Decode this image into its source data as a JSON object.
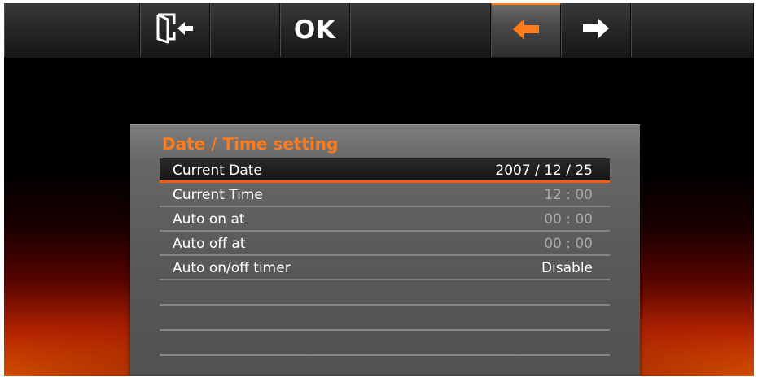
{
  "toolbar": {
    "ok_label": "OK",
    "buttons": [
      {
        "name": "exit",
        "icon": "exit-door-icon"
      },
      {
        "name": "ok",
        "label": "OK"
      },
      {
        "name": "back",
        "icon": "arrow-left-icon",
        "active": true
      },
      {
        "name": "forward",
        "icon": "arrow-right-icon"
      }
    ]
  },
  "colors": {
    "accent": "#ff7b1c",
    "selection_underline": "#ff5a14"
  },
  "panel": {
    "title": "Date / Time setting",
    "rows": [
      {
        "label": "Current Date",
        "value": "2007 / 12 / 25",
        "selected": true
      },
      {
        "label": "Current Time",
        "value": "12 : 00"
      },
      {
        "label": "Auto on at",
        "value": "00 : 00"
      },
      {
        "label": "Auto off at",
        "value": "00 : 00"
      },
      {
        "label": "Auto on/off timer",
        "value": "Disable"
      }
    ]
  }
}
